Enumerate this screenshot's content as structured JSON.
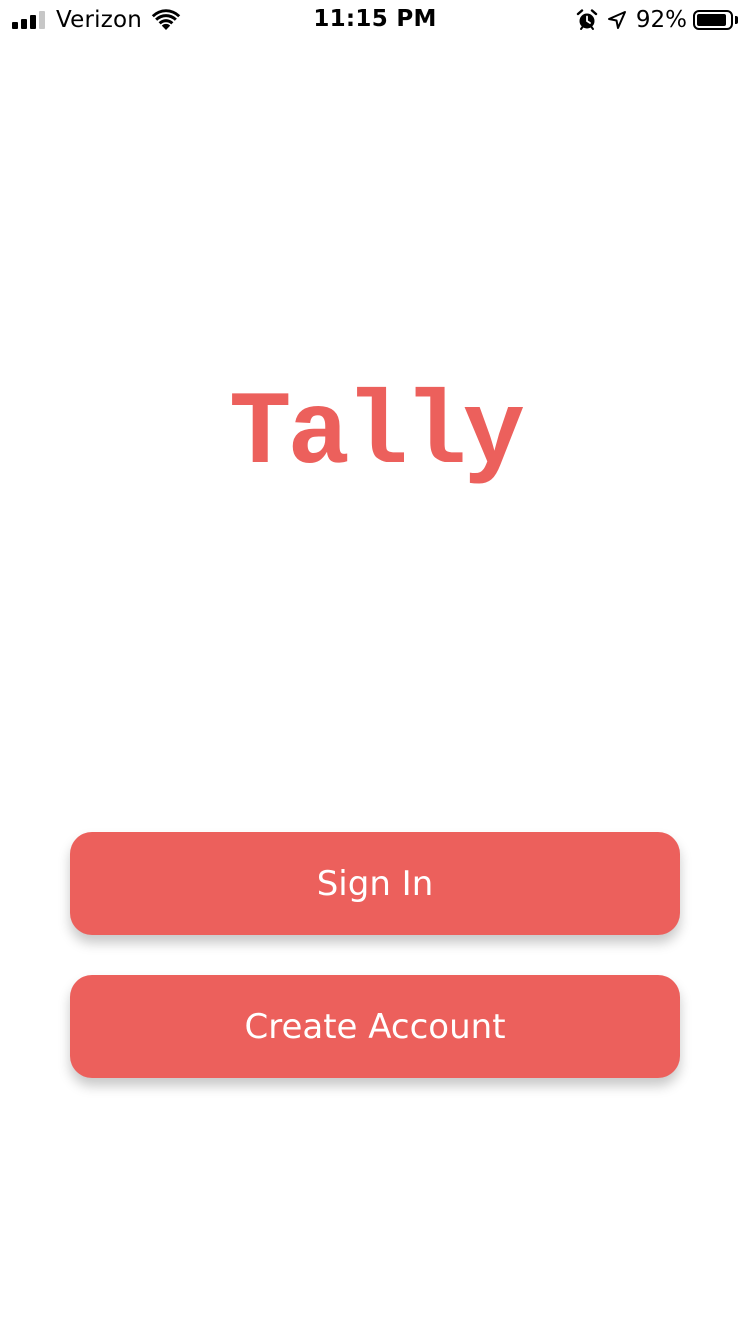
{
  "status_bar": {
    "carrier": "Verizon",
    "time": "11:15 PM",
    "battery_percent": "92%",
    "battery_level": 0.92,
    "signal_bars_filled": 3,
    "signal_bars_total": 4,
    "icons": [
      "signal-icon",
      "wifi-icon",
      "alarm-icon",
      "location-icon",
      "battery-icon"
    ]
  },
  "app": {
    "logo_text": "Tally"
  },
  "buttons": {
    "sign_in_label": "Sign In",
    "create_account_label": "Create Account"
  },
  "colors": {
    "accent": "#EC605C",
    "background": "#FFFFFF",
    "button_text": "#FFFFFF"
  }
}
